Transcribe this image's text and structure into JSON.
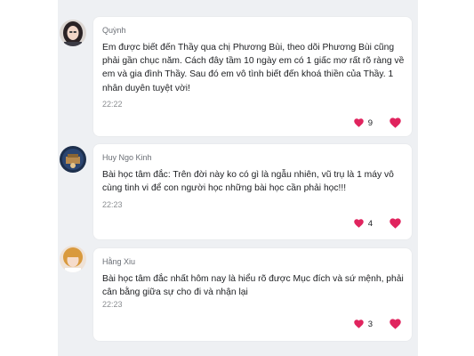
{
  "messages": [
    {
      "author": "Quỳnh",
      "text": "Em được biết đến Thầy qua chị Phương Bùi, theo dõi Phương Bùi cũng phải gần chục năm. Cách đây tầm 10 ngày em có 1 giấc mơ rất rõ ràng về em và gia đình Thầy. Sau đó em vô tình biết đến khoá thiền của Thầy. 1 nhân duyên tuyệt vời!",
      "time": "22:22",
      "reaction_count": "9",
      "avatar_icon": "avatar-photo"
    },
    {
      "author": "Huy Ngo Kinh",
      "text": "Bài học tâm đắc: Trên đời này ko có gì là ngẫu nhiên, vũ trụ là 1 máy vô cùng tinh vi để con người học những bài học cần phải học!!!",
      "time": "22:23",
      "reaction_count": "4",
      "avatar_icon": "avatar-photo"
    },
    {
      "author": "Hằng Xiu",
      "text": "Bài học tâm đắc nhất hôm nay là hiểu rõ được Mục đích và sứ mệnh, phải cân bằng giữa sự cho đi và nhận lại",
      "time": "22:23",
      "reaction_count": "3",
      "avatar_icon": "avatar-photo"
    }
  ],
  "colors": {
    "feed_background": "#eef0f3",
    "bubble_background": "#ffffff",
    "heart": "#e0245e"
  },
  "icons": {
    "reaction": "heart-icon",
    "react_button": "heart-outline-icon"
  }
}
